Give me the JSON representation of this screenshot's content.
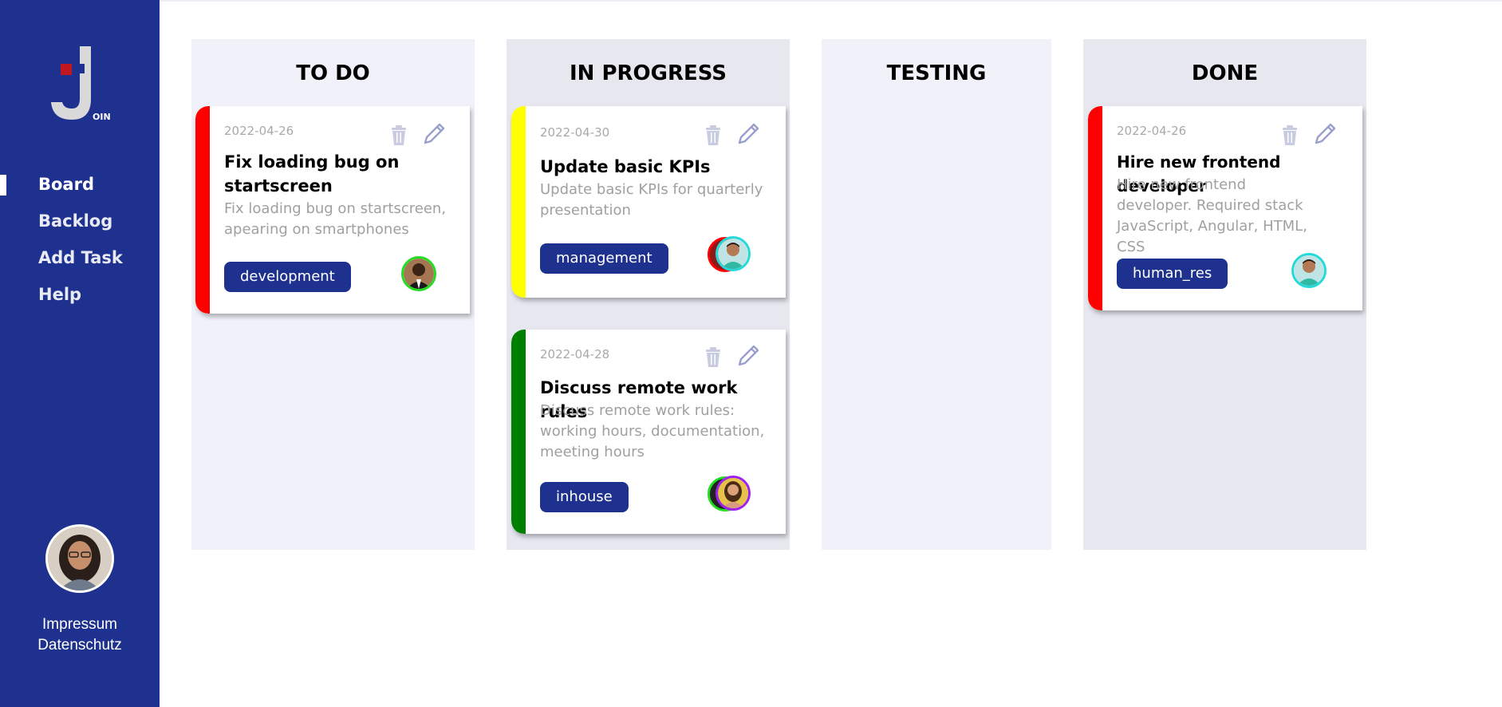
{
  "sidebar": {
    "logo_text": "OIN",
    "nav": [
      {
        "label": "Board",
        "active": true
      },
      {
        "label": "Backlog",
        "active": false
      },
      {
        "label": "Add Task",
        "active": false
      },
      {
        "label": "Help",
        "active": false
      }
    ],
    "legal": {
      "impressum": "Impressum",
      "datenschutz": "Datenschutz"
    }
  },
  "board": {
    "columns": [
      {
        "title": "TO DO"
      },
      {
        "title": "IN PROGRESS"
      },
      {
        "title": "TESTING"
      },
      {
        "title": "DONE"
      }
    ],
    "cards": [
      {
        "column": "TO DO",
        "date": "2022-04-26",
        "title": "Fix loading bug on startscreen",
        "description": "Fix loading bug on startscreen, apearing on smartphones",
        "tag": "development",
        "urgency_color": "#ff0000",
        "assignee_ring_colors": [
          "#22dd22"
        ]
      },
      {
        "column": "IN PROGRESS",
        "date": "2022-04-30",
        "title": "Update basic KPIs",
        "description": "Update basic KPIs for quarterly presentation",
        "tag": "management",
        "urgency_color": "#ffff00",
        "assignee_ring_colors": [
          "#ff0000",
          "#26d9d9"
        ]
      },
      {
        "column": "IN PROGRESS",
        "date": "2022-04-28",
        "title": "Discuss remote work rules",
        "description": "Discuss remote work rules: working hours, documentation, meeting hours",
        "tag": "inhouse",
        "urgency_color": "#008000",
        "assignee_ring_colors": [
          "#22dd22",
          "#a020f0"
        ]
      },
      {
        "column": "DONE",
        "date": "2022-04-26",
        "title": "Hire new frontend developer",
        "description": "Hire new frontend developer. Required stack JavaScript, Angular, HTML, CSS",
        "tag": "human_res",
        "urgency_color": "#ff0000",
        "assignee_ring_colors": [
          "#26d9d9"
        ]
      }
    ]
  },
  "colors": {
    "sidebar": "#1f318f",
    "tag": "#1f318f",
    "column_light": "#f1f1fa",
    "column_dark": "#e7e7f0",
    "icon": "#c9cbe0"
  }
}
